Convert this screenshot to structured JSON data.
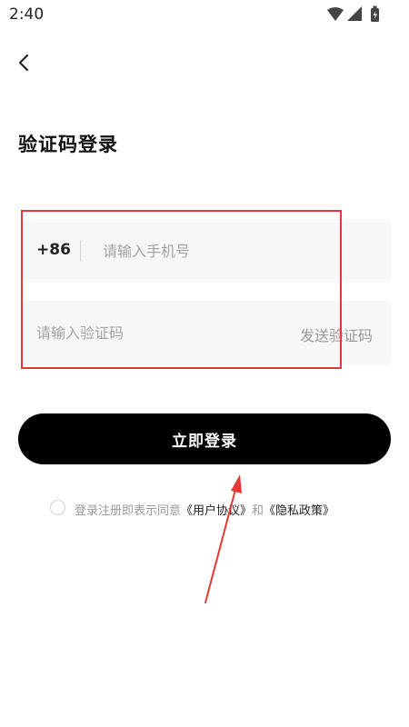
{
  "status_bar": {
    "time": "2:40",
    "icons": [
      "wifi-icon",
      "signal-icon",
      "battery-icon"
    ]
  },
  "header": {
    "back_icon": "chevron-left-icon",
    "title": "验证码登录"
  },
  "form": {
    "country_code": "+86",
    "phone_placeholder": "请输入手机号",
    "phone_value": "",
    "code_placeholder": "请输入验证码",
    "code_value": "",
    "send_code_label": "发送验证码"
  },
  "login_button_label": "立即登录",
  "agreement": {
    "checked": false,
    "prefix": "登录注册即表示同意",
    "user_agreement": "《用户协议》",
    "and": "和",
    "privacy_policy": "《隐私政策》"
  },
  "annotations": {
    "highlight_color": "#e53935"
  }
}
